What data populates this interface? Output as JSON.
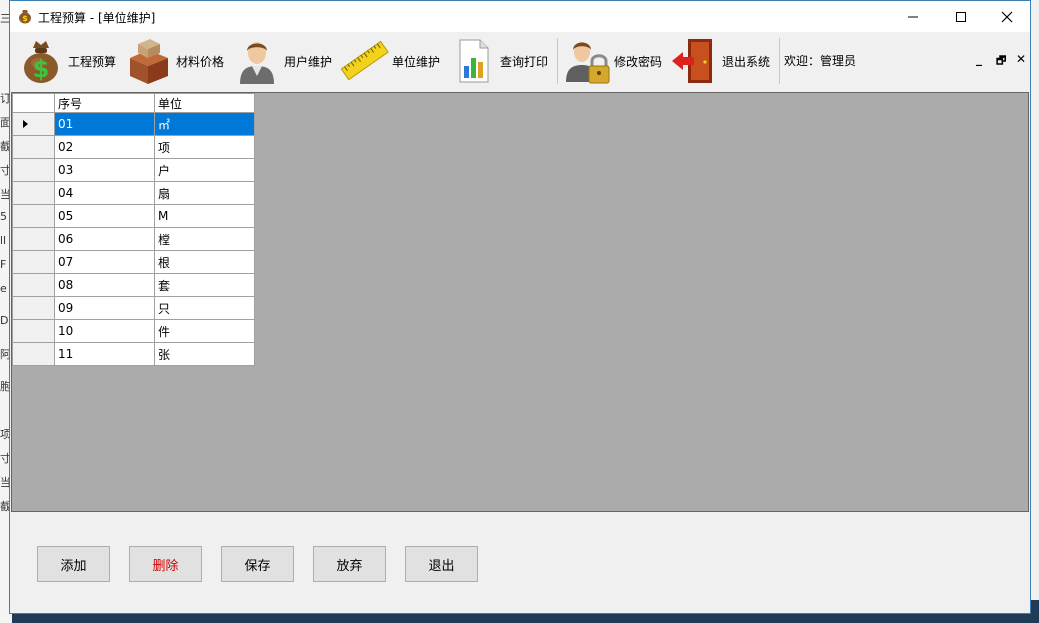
{
  "window": {
    "title": "工程预算 - [单位维护]"
  },
  "toolbar": {
    "items": [
      {
        "label": "工程预算",
        "icon": "money-bag-icon"
      },
      {
        "label": "材料价格",
        "icon": "boxes-icon"
      },
      {
        "label": "用户维护",
        "icon": "user-icon"
      },
      {
        "label": "单位维护",
        "icon": "ruler-icon"
      },
      {
        "label": "查询打印",
        "icon": "report-chart-icon"
      },
      {
        "label": "修改密码",
        "icon": "user-lock-icon"
      },
      {
        "label": "退出系统",
        "icon": "exit-door-icon"
      }
    ],
    "welcome": "欢迎：管理员"
  },
  "grid": {
    "columns": [
      "序号",
      "单位"
    ],
    "rows": [
      [
        "01",
        "㎡"
      ],
      [
        "02",
        "项"
      ],
      [
        "03",
        "户"
      ],
      [
        "04",
        "扇"
      ],
      [
        "05",
        "M"
      ],
      [
        "06",
        "樘"
      ],
      [
        "07",
        "根"
      ],
      [
        "08",
        "套"
      ],
      [
        "09",
        "只"
      ],
      [
        "10",
        "件"
      ],
      [
        "11",
        "张"
      ]
    ],
    "selected_row": 0
  },
  "buttons": {
    "add": "添加",
    "delete": "删除",
    "save": "保存",
    "discard": "放弃",
    "exit": "退出"
  },
  "colors": {
    "selection": "#0078d7",
    "delete_text": "#d40000"
  }
}
